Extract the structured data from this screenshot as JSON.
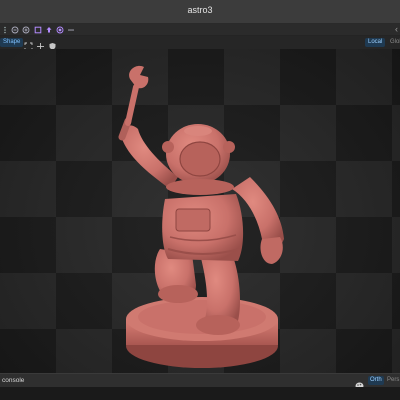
{
  "window": {
    "title": "astro3"
  },
  "toolbar": {
    "icons": [
      "menu-dots-icon",
      "zoom-out-icon",
      "zoom-in-icon",
      "frame-icon",
      "upload-icon",
      "record-icon",
      "more-icon",
      "share-icon"
    ]
  },
  "subbar": {
    "shape_label": "Shape",
    "local_label": "Local",
    "global_label": "Glob",
    "icons": [
      "fit-icon",
      "move-icon",
      "shield-icon"
    ]
  },
  "viewport": {
    "model_name": "astronaut with wrench figurine",
    "model_color": "#c9716a",
    "checker_colors": [
      "#2a2a2a",
      "#1c1c1c"
    ]
  },
  "statusbar": {
    "console_label": "console",
    "orth_label": "Orth",
    "persp_label": "Pers"
  }
}
